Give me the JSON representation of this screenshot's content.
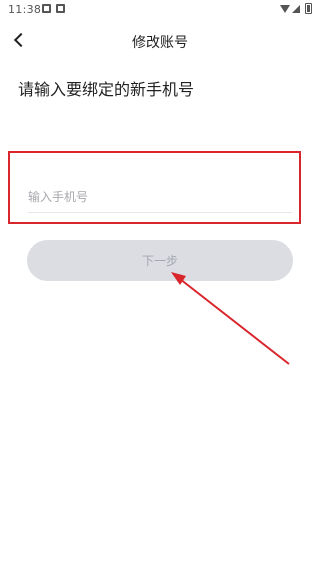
{
  "status_bar": {
    "time": "11:38"
  },
  "nav": {
    "title": "修改账号"
  },
  "main": {
    "heading": "请输入要绑定的新手机号",
    "phone_input": {
      "placeholder": "输入手机号",
      "value": ""
    },
    "next_button_label": "下一步"
  },
  "colors": {
    "annotation_red": "#d9262c",
    "button_disabled_bg": "#dcdde2",
    "button_disabled_text": "#a5a7b0"
  }
}
